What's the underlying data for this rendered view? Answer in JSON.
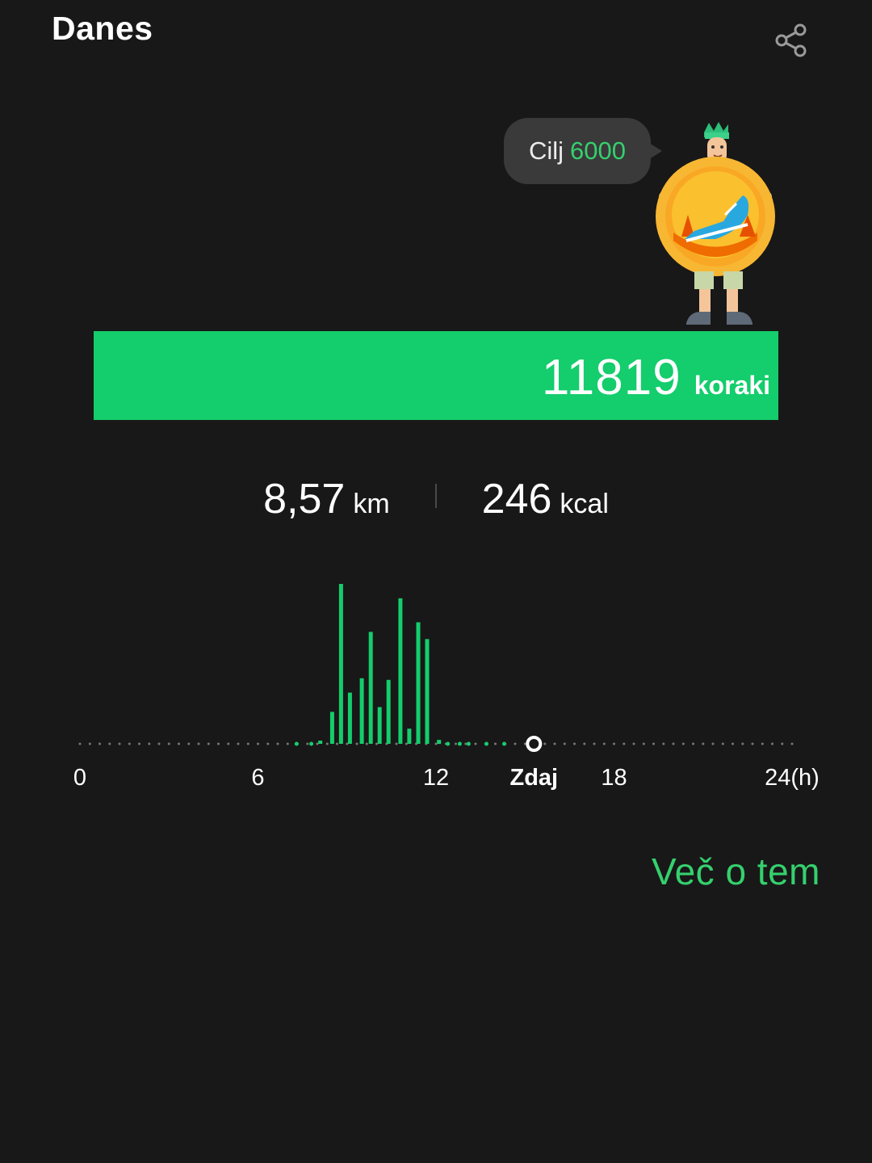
{
  "header": {
    "title": "Danes",
    "share_icon": "share-icon"
  },
  "goal": {
    "label": "Cilj",
    "value": "6000"
  },
  "steps": {
    "count": "11819",
    "unit": "koraki",
    "goal_progress": 1.0
  },
  "stats": {
    "distance": {
      "value": "8,57",
      "unit": "km"
    },
    "calories": {
      "value": "246",
      "unit": "kcal"
    }
  },
  "colors": {
    "accent": "#14cd6c",
    "background": "#181818",
    "bubble": "#3a3a3a"
  },
  "chart_data": {
    "type": "bar",
    "x_ticks": [
      "0",
      "6",
      "12",
      "Zdaj",
      "18",
      "24(h)"
    ],
    "now_hour": 15.3,
    "hours": [
      7.3,
      7.8,
      8.1,
      8.5,
      8.8,
      9.1,
      9.5,
      9.8,
      10.1,
      10.4,
      10.8,
      11.1,
      11.4,
      11.7,
      12.1,
      12.4,
      12.8,
      13.1,
      13.7,
      14.3
    ],
    "values": [
      0.2,
      0.2,
      0.4,
      4.0,
      20.0,
      6.4,
      8.2,
      14.0,
      4.6,
      8.0,
      18.2,
      1.9,
      15.2,
      13.1,
      0.5,
      0.3,
      0.3,
      0.3,
      0.2,
      0.2
    ]
  },
  "footer": {
    "more_link": "Več o tem"
  }
}
